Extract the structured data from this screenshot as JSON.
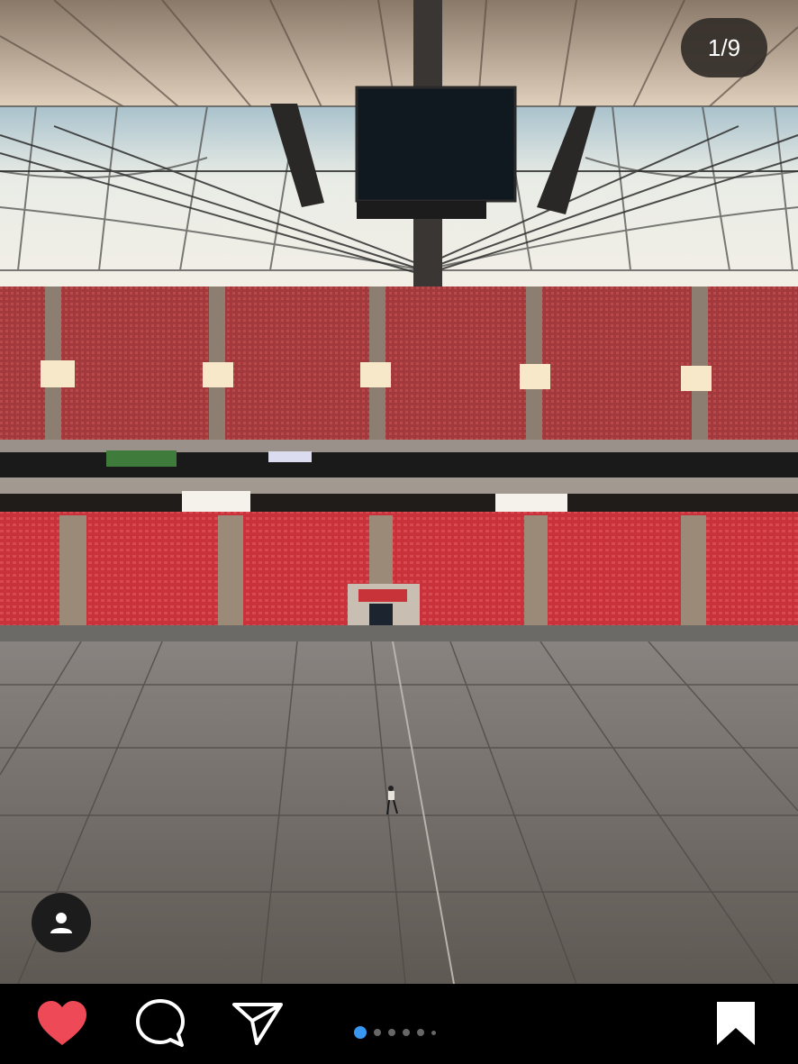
{
  "post": {
    "photo_alt": "",
    "counter": "1/9",
    "carousel": {
      "total_dots": 6,
      "active_index": 0
    }
  },
  "actions": {
    "like_icon": "heart-filled",
    "comment_icon": "speech-bubble",
    "share_icon": "paper-plane",
    "save_icon": "bookmark-filled",
    "like_color": "#ed4956"
  },
  "colors": {
    "seat_red": "#c8333a",
    "floor": "#6e6862",
    "canopy": "#e6e4dd",
    "accent_blue": "#3897f0"
  }
}
